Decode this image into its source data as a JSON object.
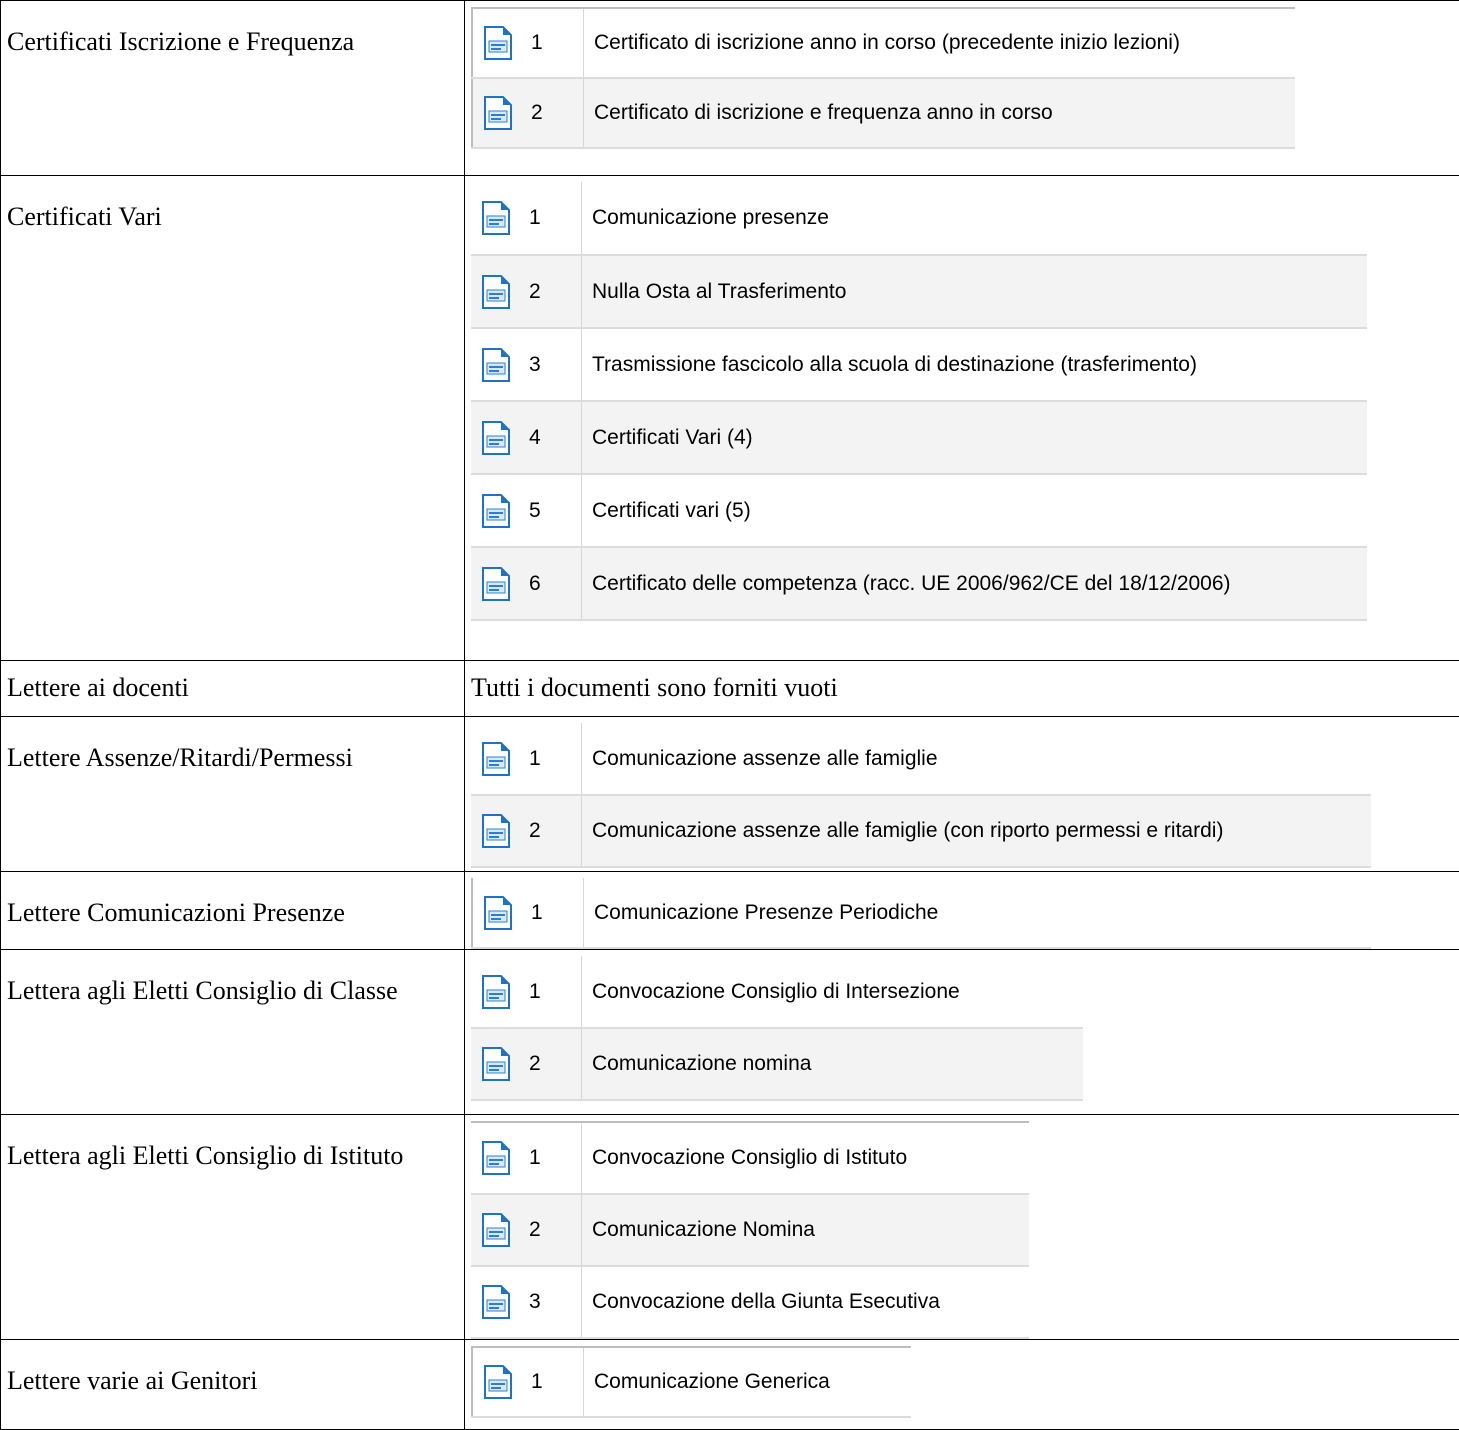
{
  "rows": [
    {
      "category": "Certificati Iscrizione e Frequenza",
      "items": [
        {
          "num": "1",
          "title": "Certificato di iscrizione anno in corso (precedente inizio lezioni)"
        },
        {
          "num": "2",
          "title": "Certificato di iscrizione e frequenza anno in corso"
        }
      ]
    },
    {
      "category": "Certificati Vari",
      "items": [
        {
          "num": "1",
          "title": "Comunicazione presenze"
        },
        {
          "num": "2",
          "title": "Nulla Osta al Trasferimento"
        },
        {
          "num": "3",
          "title": "Trasmissione fascicolo alla scuola di destinazione (trasferimento)"
        },
        {
          "num": "4",
          "title": "Certificati Vari (4)"
        },
        {
          "num": "5",
          "title": "Certificati vari (5)"
        },
        {
          "num": "6",
          "title": "Certificato delle competenza (racc. UE 2006/962/CE del 18/12/2006)"
        }
      ]
    },
    {
      "category": "Lettere ai docenti",
      "message": "Tutti i documenti sono forniti vuoti"
    },
    {
      "category": "Lettere Assenze/Ritardi/Permessi",
      "items": [
        {
          "num": "1",
          "title": "Comunicazione assenze alle famiglie"
        },
        {
          "num": "2",
          "title": "Comunicazione assenze alle famiglie (con riporto permessi e ritardi)"
        }
      ]
    },
    {
      "category": "Lettere Comunicazioni Presenze",
      "items": [
        {
          "num": "1",
          "title": "Comunicazione Presenze Periodiche"
        }
      ]
    },
    {
      "category": "Lettera agli Eletti Consiglio di Classe",
      "items": [
        {
          "num": "1",
          "title": "Convocazione Consiglio di Intersezione"
        },
        {
          "num": "2",
          "title": "Comunicazione nomina"
        }
      ]
    },
    {
      "category": "Lettera agli Eletti Consiglio di Istituto",
      "items": [
        {
          "num": "1",
          "title": "Convocazione Consiglio di Istituto"
        },
        {
          "num": "2",
          "title": "Comunicazione Nomina"
        },
        {
          "num": "3",
          "title": "Convocazione della Giunta Esecutiva"
        }
      ]
    },
    {
      "category": "Lettere varie ai Genitori",
      "items": [
        {
          "num": "1",
          "title": "Comunicazione Generica"
        }
      ]
    }
  ],
  "icon": "libreoffice-writer-document-icon",
  "colors": {
    "border": "#000000",
    "row_alt": "#f3f3f3",
    "row_line": "#dcdcdc",
    "icon_blue": "#2a7fd4"
  }
}
